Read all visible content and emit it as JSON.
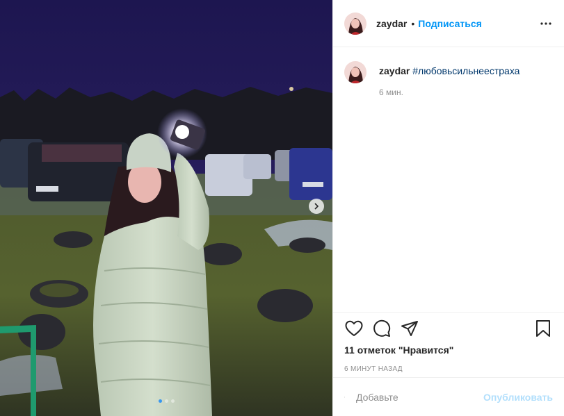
{
  "header": {
    "username": "zaydar",
    "separator": "•",
    "follow_label": "Подписаться",
    "more_icon": "more-horizontal-icon"
  },
  "caption": {
    "username": "zaydar",
    "text": "#любовьсильнеестраха",
    "time": "6 мин."
  },
  "actions": {
    "like_icon": "heart-icon",
    "comment_icon": "comment-icon",
    "share_icon": "share-icon",
    "save_icon": "bookmark-icon",
    "likes": "11 отметок \"Нравится\"",
    "time_ago": "6 минут назад"
  },
  "comment_box": {
    "placeholder": "Добавьте",
    "publish_label": "Опубликовать"
  },
  "carousel": {
    "slide_count": 3,
    "active_slide": 1
  },
  "colors": {
    "accent": "#0095f6",
    "publish_disabled": "#b2dffc",
    "muted": "#8e8e8e",
    "border": "#efefef"
  }
}
